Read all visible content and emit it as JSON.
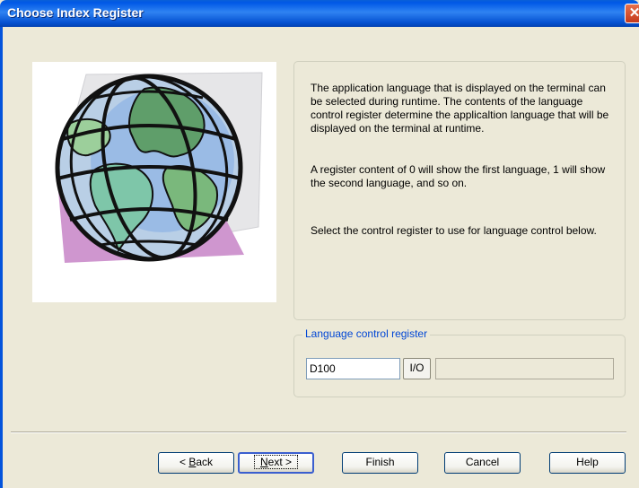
{
  "window": {
    "title": "Choose Index Register",
    "close_glyph": "✕"
  },
  "illustration": {
    "icon": "globe-illustration-icon"
  },
  "description": {
    "paragraph1": "The application language that is displayed on the terminal can be selected during runtime. The contents of the language control register determine the applicaltion language that will be displayed on the terminal at runtime.",
    "paragraph2": "A register content of 0 will show the first language, 1 will show the second language, and so on.",
    "paragraph3": "Select the control register to use for language control below."
  },
  "register": {
    "legend": "Language control register",
    "value": "D100",
    "io_label": "I/O",
    "display_value": ""
  },
  "buttons": {
    "back_prefix": "< ",
    "back_mnemonic": "B",
    "back_rest": "ack",
    "next_mnemonic": "N",
    "next_rest": "ext >",
    "finish": "Finish",
    "cancel": "Cancel",
    "help": "Help"
  },
  "colors": {
    "titlebar": "#0058e6",
    "dialog_bg": "#ece9d8",
    "legend_text": "#0046d5"
  }
}
